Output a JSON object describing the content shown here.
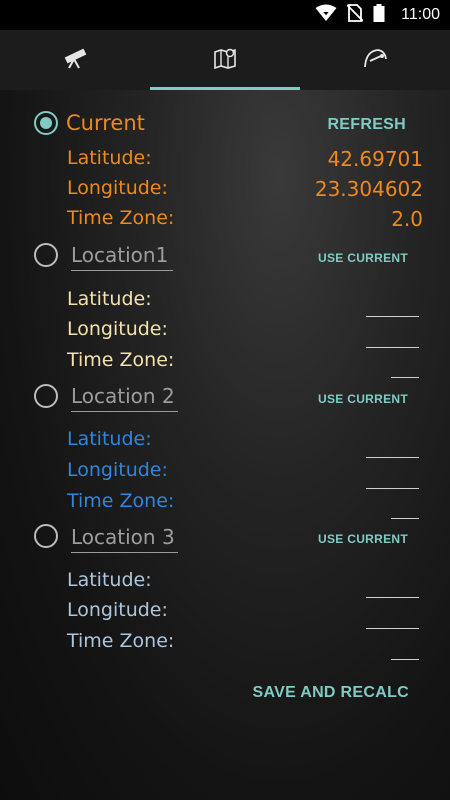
{
  "status_bar": {
    "time": "11:00",
    "icons": [
      "wifi-icon",
      "no-sim-icon",
      "battery-icon"
    ]
  },
  "tabs": [
    {
      "icon": "telescope-icon",
      "active": false
    },
    {
      "icon": "map-pin-icon",
      "active": true
    },
    {
      "icon": "orbit-icon",
      "active": false
    }
  ],
  "current": {
    "label": "Current",
    "selected": true,
    "refresh_label": "REFRESH",
    "latitude_label": "Latitude:",
    "longitude_label": "Longitude:",
    "timezone_label": "Time Zone:",
    "latitude": "42.69701",
    "longitude": "23.304602",
    "timezone": "2.0"
  },
  "locations": [
    {
      "placeholder": "Location1",
      "use_current_label": "USE CURRENT",
      "latitude_label": "Latitude:",
      "longitude_label": "Longitude:",
      "timezone_label": "Time Zone:",
      "latitude": "",
      "longitude": "",
      "timezone": ""
    },
    {
      "placeholder": "Location 2",
      "use_current_label": "USE CURRENT",
      "latitude_label": "Latitude:",
      "longitude_label": "Longitude:",
      "timezone_label": "Time Zone:",
      "latitude": "",
      "longitude": "",
      "timezone": ""
    },
    {
      "placeholder": "Location 3",
      "use_current_label": "USE CURRENT",
      "latitude_label": "Latitude:",
      "longitude_label": "Longitude:",
      "timezone_label": "Time Zone:",
      "latitude": "",
      "longitude": "",
      "timezone": ""
    }
  ],
  "save_label": "SAVE AND RECALC",
  "colors": {
    "accent": "#80cbc4",
    "current_text": "#f0891c",
    "location1_text": "#f3e2ab",
    "location2_text": "#2f86de",
    "location3_text": "#aec6dc"
  }
}
